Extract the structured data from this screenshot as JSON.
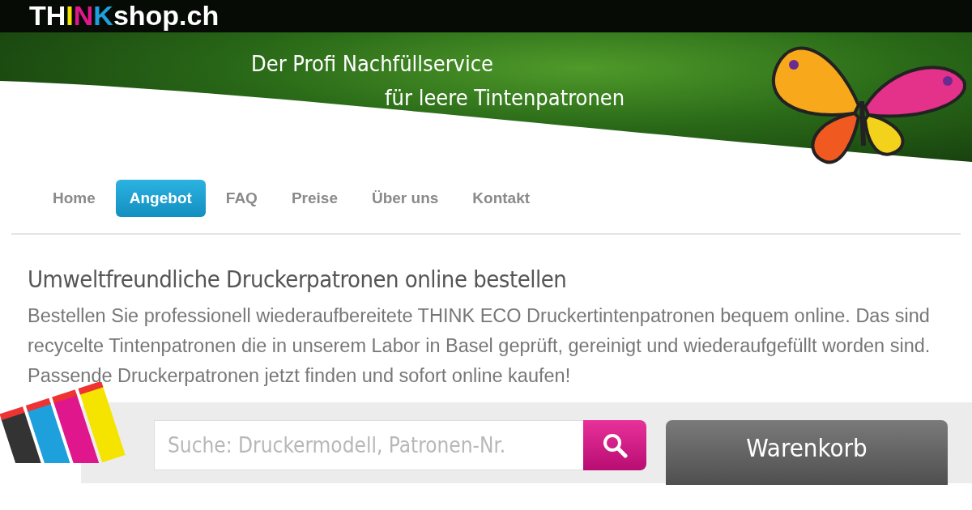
{
  "logo": [
    {
      "text": "TH",
      "color": "#ffffff"
    },
    {
      "text": "I",
      "color": "#f5e400"
    },
    {
      "text": "N",
      "color": "#e0168c"
    },
    {
      "text": "K",
      "color": "#1ea0dc"
    },
    {
      "text": "shop.ch",
      "color": "#ffffff"
    }
  ],
  "tagline": [
    "Der Profi Nachfüllservice",
    "für leere Tintenpatronen"
  ],
  "nav": [
    {
      "label": "Home",
      "selected": false
    },
    {
      "label": "Angebot",
      "selected": true
    },
    {
      "label": "FAQ",
      "selected": false
    },
    {
      "label": "Preise",
      "selected": false
    },
    {
      "label": "Über uns",
      "selected": false
    },
    {
      "label": "Kontakt",
      "selected": false
    }
  ],
  "heading": "Umweltfreundliche Druckerpatronen online bestellen",
  "intro": "Bestellen Sie professionell wiederaufbereitete THINK ECO Druckertintenpatronen bequem online. Das sind recycelte Tintenpatronen die in unserem Labor in Basel geprüft, gereinigt und wiederaufgefüllt worden sind. Passende Druckerpatronen jetzt finden und sofort online kaufen!",
  "search": {
    "placeholder": "Suche: Druckermodell, Patronen-Nr."
  },
  "cart": {
    "title": "Warenkorb"
  }
}
